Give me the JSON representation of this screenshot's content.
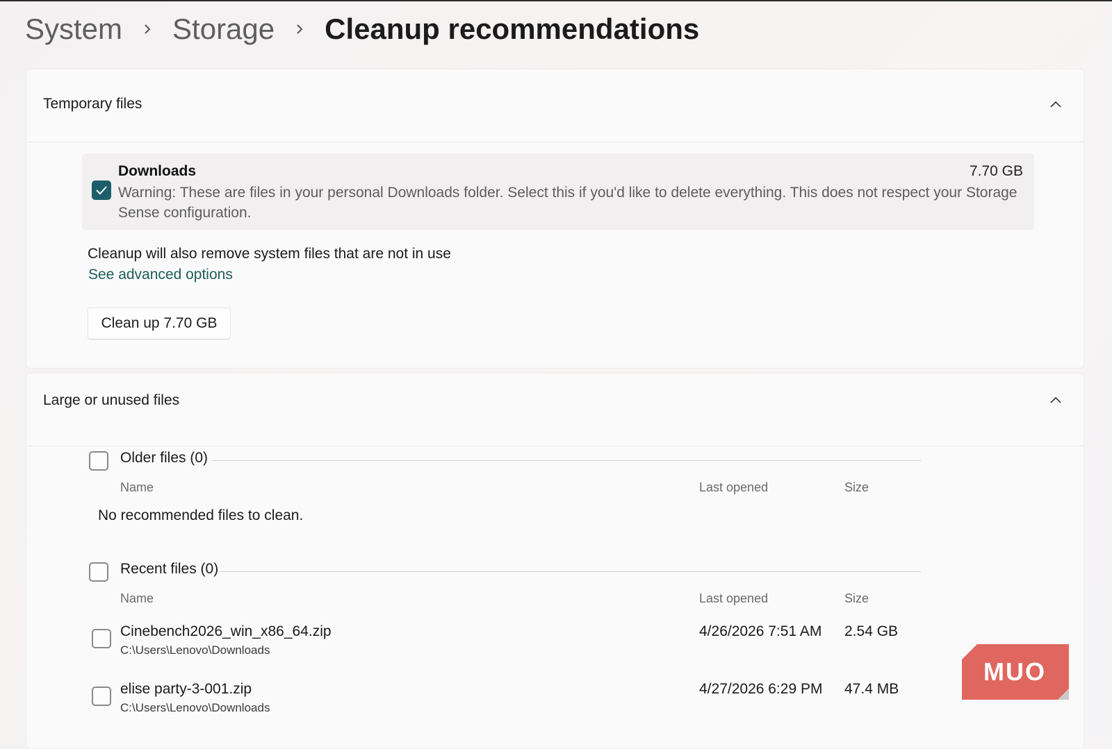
{
  "breadcrumb": {
    "items": [
      "System",
      "Storage",
      "Cleanup recommendations"
    ]
  },
  "temporary_files": {
    "title": "Temporary files",
    "downloads": {
      "title": "Downloads",
      "size": "7.70 GB",
      "description": "Warning: These are files in your personal Downloads folder. Select this if you'd like to delete everything. This does not respect your Storage Sense configuration.",
      "checked": true
    },
    "info": "Cleanup will also remove system files that are not in use",
    "advanced_link": "See advanced options",
    "cleanup_button": "Clean up 7.70 GB"
  },
  "large_files": {
    "title": "Large or unused files",
    "older": {
      "label": "Older files (0)",
      "col_name": "Name",
      "col_last_opened": "Last opened",
      "col_size": "Size",
      "empty": "No recommended files to clean."
    },
    "recent": {
      "label": "Recent files (0)",
      "col_name": "Name",
      "col_last_opened": "Last opened",
      "col_size": "Size",
      "files": [
        {
          "name": "Cinebench2026_win_x86_64.zip",
          "path": "C:\\Users\\Lenovo\\Downloads",
          "last_opened": "4/26/2026 7:51 AM",
          "size": "2.54 GB"
        },
        {
          "name": "elise party-3-001.zip",
          "path": "C:\\Users\\Lenovo\\Downloads",
          "last_opened": "4/27/2026 6:29 PM",
          "size": "47.4 MB"
        }
      ]
    }
  },
  "watermark": {
    "text": "MUO"
  },
  "colors": {
    "accent": "#1c5f6b",
    "link": "#1d5c5a",
    "watermark": "#e0675f"
  },
  "icons": [
    "chevron-right-icon",
    "chevron-up-icon",
    "checkmark-icon"
  ]
}
